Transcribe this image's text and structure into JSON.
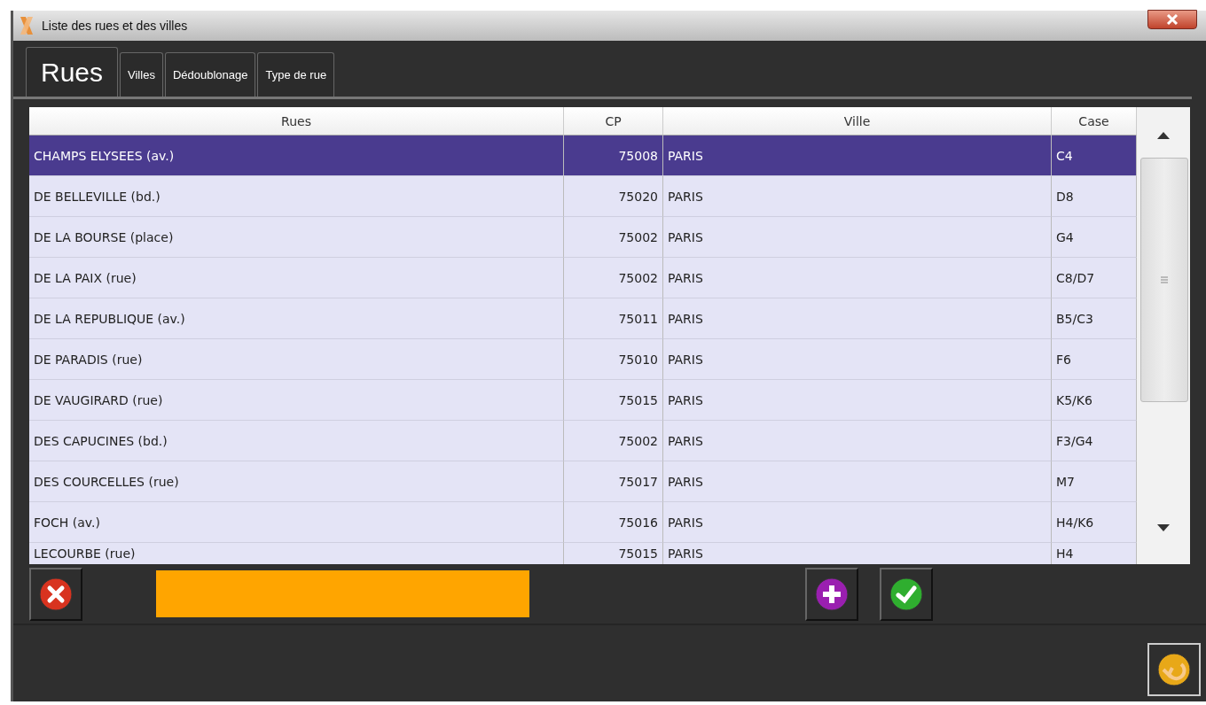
{
  "window": {
    "title": "Liste des rues et des villes"
  },
  "tabs": [
    {
      "label": "Rues",
      "selected": true
    },
    {
      "label": "Villes",
      "selected": false
    },
    {
      "label": "Dédoublonage",
      "selected": false
    },
    {
      "label": "Type de rue",
      "selected": false
    }
  ],
  "table": {
    "columns": [
      "Rues",
      "CP",
      "Ville",
      "Case"
    ],
    "rows": [
      {
        "cells": [
          "CHAMPS ELYSEES (av.)",
          "75008",
          "PARIS",
          "C4"
        ],
        "selected": true
      },
      {
        "cells": [
          "DE BELLEVILLE (bd.)",
          "75020",
          "PARIS",
          "D8"
        ],
        "selected": false
      },
      {
        "cells": [
          "DE LA BOURSE (place)",
          "75002",
          "PARIS",
          "G4"
        ],
        "selected": false
      },
      {
        "cells": [
          "DE LA PAIX (rue)",
          "75002",
          "PARIS",
          "C8/D7"
        ],
        "selected": false
      },
      {
        "cells": [
          "DE LA REPUBLIQUE (av.)",
          "75011",
          "PARIS",
          "B5/C3"
        ],
        "selected": false
      },
      {
        "cells": [
          "DE PARADIS (rue)",
          "75010",
          "PARIS",
          "F6"
        ],
        "selected": false
      },
      {
        "cells": [
          "DE VAUGIRARD (rue)",
          "75015",
          "PARIS",
          "K5/K6"
        ],
        "selected": false
      },
      {
        "cells": [
          "DES CAPUCINES (bd.)",
          "75002",
          "PARIS",
          "F3/G4"
        ],
        "selected": false
      },
      {
        "cells": [
          "DES COURCELLES (rue)",
          "75017",
          "PARIS",
          "M7"
        ],
        "selected": false
      },
      {
        "cells": [
          "FOCH (av.)",
          "75016",
          "PARIS",
          "H4/K6"
        ],
        "selected": false
      },
      {
        "cells": [
          "LECOURBE (rue)",
          "75015",
          "PARIS",
          "H4"
        ],
        "selected": false
      }
    ]
  }
}
